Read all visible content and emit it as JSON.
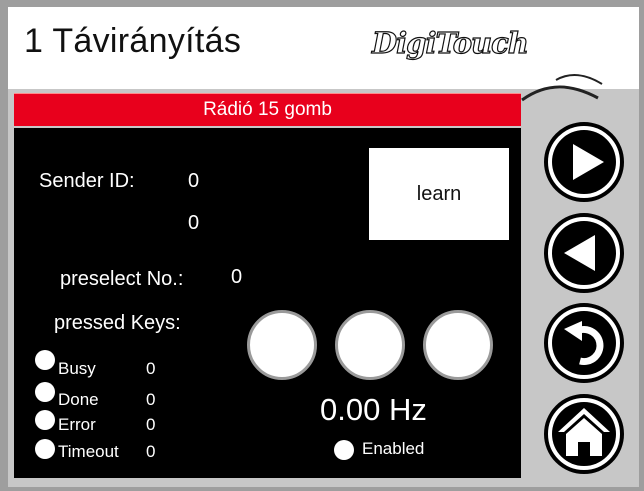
{
  "header": {
    "title": "1 Távirányítás",
    "logo_text": "DigiTouch"
  },
  "panel": {
    "banner": "Rádió 15 gomb",
    "sender_id_label": "Sender ID:",
    "sender_id_value_1": "0",
    "sender_id_value_2": "0",
    "learn_label": "learn",
    "preselect_label": "preselect No.:",
    "preselect_value": "0",
    "pressed_keys_label": "pressed Keys:",
    "status": [
      {
        "label": "Busy",
        "value": "0"
      },
      {
        "label": "Done",
        "value": "0"
      },
      {
        "label": "Error",
        "value": "0"
      },
      {
        "label": "Timeout",
        "value": "0"
      }
    ],
    "frequency": "0.00 Hz",
    "enabled_label": "Enabled"
  },
  "nav": {
    "icons": [
      "play-forward-icon",
      "play-back-icon",
      "return-icon",
      "home-icon"
    ]
  },
  "colors": {
    "banner_red": "#e8001c",
    "background_gray": "#c7c7c7",
    "panel_black": "#000000"
  }
}
